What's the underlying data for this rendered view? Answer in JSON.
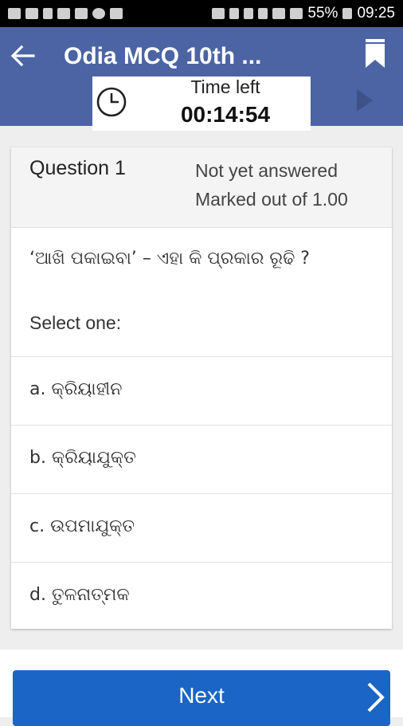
{
  "status_bar": {
    "battery": "55%",
    "time": "09:25"
  },
  "app_bar": {
    "title": "Odia MCQ 10th ..."
  },
  "timer": {
    "label": "Time left",
    "value": "00:14:54"
  },
  "question": {
    "number": "Question 1",
    "state": "Not yet answered",
    "marks": "Marked out of 1.00",
    "text": "‘ଆଖି ପକାଇବା’ – ଏହା କି ପ୍ରକାର ରୂଢି ?",
    "prompt": "Select one:",
    "options": [
      {
        "label": "a. କ୍ରିୟାହୀନ"
      },
      {
        "label": "b. କ୍ରିୟାଯୁକ୍ତ"
      },
      {
        "label": "c. ଉପମାଯୁକ୍ତ"
      },
      {
        "label": "d. ତୁଳନାତ୍ମକ"
      }
    ]
  },
  "footer": {
    "next_label": "Next"
  },
  "colors": {
    "app_bar": "#4c64a4",
    "next_button": "#1a65c6"
  }
}
